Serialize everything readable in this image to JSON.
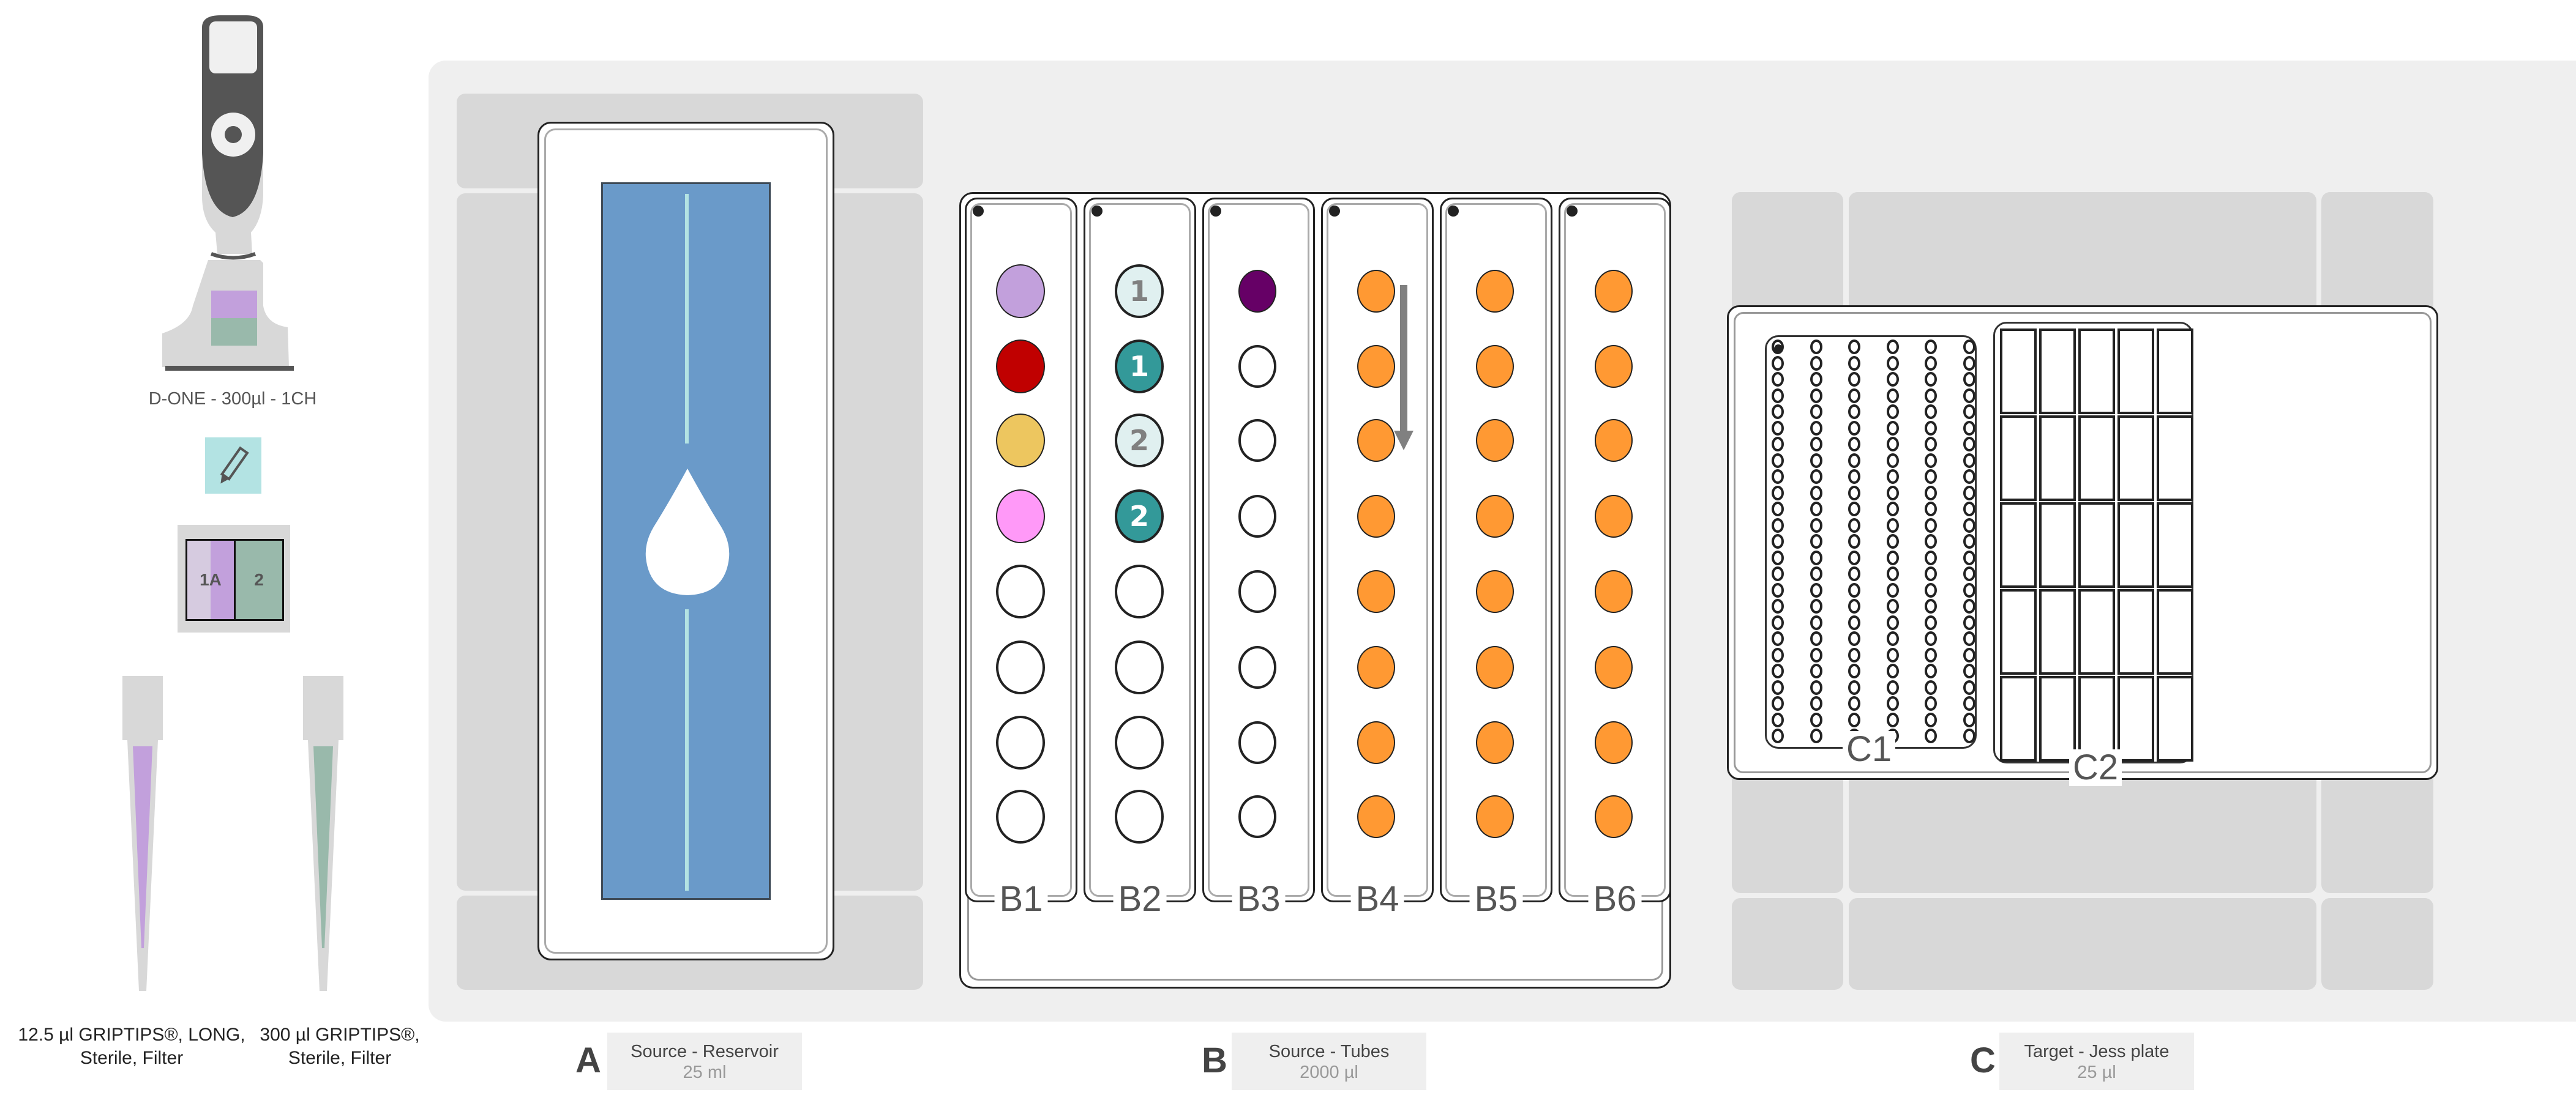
{
  "pipette": {
    "label": "D-ONE - 300µl - 1CH",
    "icon": "pipette-icon",
    "colors": {
      "body": "#555555",
      "handle": "#d8d8d8",
      "screen": "#f0f0f0",
      "channel_a": "#c2a0dc",
      "channel_b": "#99b9ab"
    }
  },
  "edit_button": {
    "icon": "pencil-icon",
    "color": "#b3e3e3"
  },
  "tip_map": {
    "cells": [
      {
        "label": "1A",
        "color": "#c2a0dc"
      },
      {
        "label": "2",
        "color": "#99b9ab"
      }
    ]
  },
  "tips": [
    {
      "caption": "12.5 µl GRIPTIPS®, LONG, Sterile, Filter",
      "color": "#c2a0dc"
    },
    {
      "caption": "300 µl GRIPTIPS®, Sterile, Filter",
      "color": "#99b9ab"
    }
  ],
  "bays": [
    {
      "letter": "A",
      "title": "Source - Reservoir",
      "volume": "25 ml"
    },
    {
      "letter": "B",
      "title": "Source - Tubes",
      "volume": "2000 µl"
    },
    {
      "letter": "C",
      "title": "Target - Jess plate",
      "volume": "25 µl"
    }
  ],
  "reservoir": {
    "liquid_color": "#6a9ac9",
    "icon": "droplet-icon"
  },
  "tube_rack": {
    "columns": [
      {
        "label": "B1",
        "size": "large",
        "tubes": [
          {
            "fill": "#c2a0dc"
          },
          {
            "fill": "#c00000"
          },
          {
            "fill": "#edc65f"
          },
          {
            "fill": "#ff99f8"
          },
          {
            "fill": null
          },
          {
            "fill": null
          },
          {
            "fill": null
          },
          {
            "fill": null
          }
        ]
      },
      {
        "label": "B2",
        "size": "large",
        "tubes": [
          {
            "fill": "#e0f0f0",
            "text": "1",
            "text_color": "#808080"
          },
          {
            "fill": "#339999",
            "text": "1",
            "text_color": "#ffffff"
          },
          {
            "fill": "#e0f0f0",
            "text": "2",
            "text_color": "#808080"
          },
          {
            "fill": "#339999",
            "text": "2",
            "text_color": "#ffffff"
          },
          {
            "fill": null
          },
          {
            "fill": null
          },
          {
            "fill": null
          },
          {
            "fill": null
          }
        ]
      },
      {
        "label": "B3",
        "size": "small",
        "tubes": [
          {
            "fill": "#660066"
          },
          {
            "fill": null
          },
          {
            "fill": null
          },
          {
            "fill": null
          },
          {
            "fill": null
          },
          {
            "fill": null
          },
          {
            "fill": null
          },
          {
            "fill": null
          }
        ]
      },
      {
        "label": "B4",
        "size": "small",
        "arrow": true,
        "tubes": [
          {
            "fill": "#ff9933"
          },
          {
            "fill": "#ff9933"
          },
          {
            "fill": "#ff9933"
          },
          {
            "fill": "#ff9933"
          },
          {
            "fill": "#ff9933"
          },
          {
            "fill": "#ff9933"
          },
          {
            "fill": "#ff9933"
          },
          {
            "fill": "#ff9933"
          }
        ]
      },
      {
        "label": "B5",
        "size": "small",
        "tubes": [
          {
            "fill": "#ff9933"
          },
          {
            "fill": "#ff9933"
          },
          {
            "fill": "#ff9933"
          },
          {
            "fill": "#ff9933"
          },
          {
            "fill": "#ff9933"
          },
          {
            "fill": "#ff9933"
          },
          {
            "fill": "#ff9933"
          },
          {
            "fill": "#ff9933"
          }
        ]
      },
      {
        "label": "B6",
        "size": "small",
        "tubes": [
          {
            "fill": "#ff9933"
          },
          {
            "fill": "#ff9933"
          },
          {
            "fill": "#ff9933"
          },
          {
            "fill": "#ff9933"
          },
          {
            "fill": "#ff9933"
          },
          {
            "fill": "#ff9933"
          },
          {
            "fill": "#ff9933"
          },
          {
            "fill": "#ff9933"
          }
        ]
      }
    ]
  },
  "jess_plate": {
    "c1": {
      "label": "C1",
      "rows": 25,
      "cols": 6
    },
    "c2": {
      "label": "C2",
      "rows": 5,
      "cols": 5
    }
  }
}
